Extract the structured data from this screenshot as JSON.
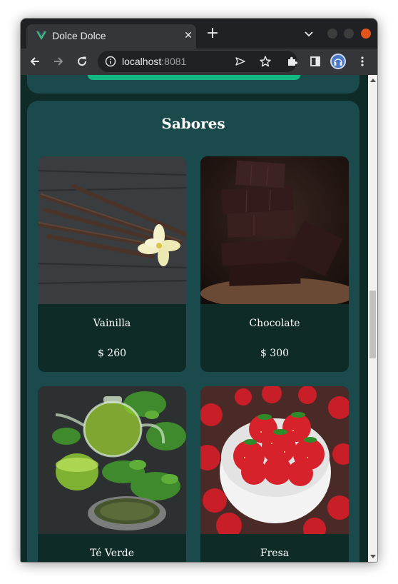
{
  "browser": {
    "tab_title": "Dolce Dolce",
    "close_glyph": "✕",
    "new_tab_glyph": "+",
    "url_host": "localhost",
    "url_port": ":8081"
  },
  "page": {
    "section_title": "Sabores",
    "cards": [
      {
        "name": "Vainilla",
        "price": "$ 260",
        "image": "vanilla-image"
      },
      {
        "name": "Chocolate",
        "price": "$ 300",
        "image": "chocolate-image"
      },
      {
        "name": "Té Verde",
        "price": "",
        "image": "green-tea-image"
      },
      {
        "name": "Fresa",
        "price": "",
        "image": "strawberry-image"
      }
    ]
  },
  "colors": {
    "page_bg": "#0f2b28",
    "section_bg": "#1b4a4d",
    "accent": "#12b982",
    "text": "#ffffff"
  }
}
